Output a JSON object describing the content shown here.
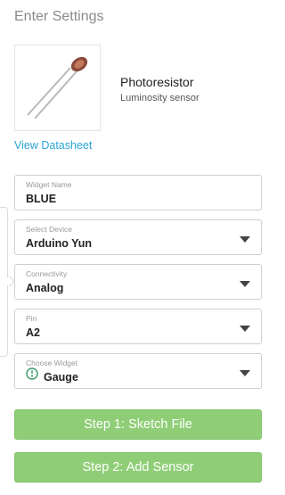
{
  "header": {
    "title": "Enter Settings"
  },
  "sensor": {
    "name": "Photoresistor",
    "description": "Luminosity sensor",
    "datasheet_link": "View Datasheet",
    "image_icon": "photoresistor-icon"
  },
  "form": {
    "widget_name": {
      "label": "Widget Name",
      "value": "BLUE"
    },
    "device": {
      "label": "Select Device",
      "value": "Arduino Yun"
    },
    "connectivity": {
      "label": "Connectivity",
      "value": "Analog"
    },
    "pin": {
      "label": "Pin",
      "value": "A2"
    },
    "widget": {
      "label": "Choose Widget",
      "value": "Gauge",
      "icon": "gauge-icon"
    }
  },
  "buttons": {
    "step1": "Step 1: Sketch File",
    "step2": "Step 2: Add Sensor"
  },
  "colors": {
    "accent_link": "#2aa5d6",
    "button_green": "#8fce77",
    "gauge_icon": "#3a9a6a"
  }
}
